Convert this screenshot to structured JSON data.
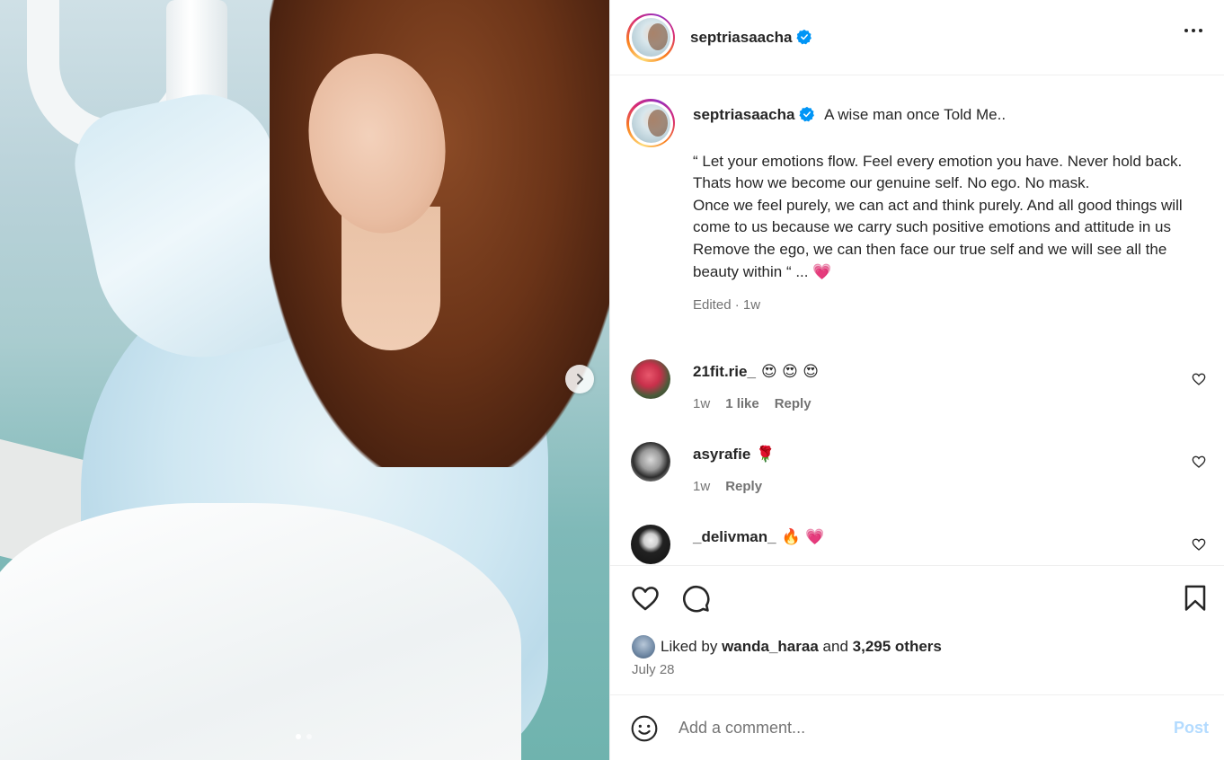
{
  "post": {
    "author": "septriasaacha",
    "verified_icon": "verified-badge-icon",
    "more_icon": "more-options-icon",
    "carousel": {
      "current_index": 1,
      "total": 2,
      "next_icon": "chevron-right-icon"
    }
  },
  "caption": {
    "username": "septriasaacha",
    "first_line": "A wise man once Told Me..",
    "body": "“ Let your emotions flow. Feel every emotion you have. Never hold back. Thats how we become our genuine self. No ego. No mask.\nOnce we feel purely, we can act and think purely. And all good things will come to us because we carry such positive emotions and attitude in us\nRemove the ego, we can then face our true self and we will see all the beauty within “ ... 💗",
    "meta": "Edited · 1w"
  },
  "comments": [
    {
      "username": "21fit.rie_",
      "text": "😍 😍 😍",
      "time": "1w",
      "likes": "1 like",
      "reply": "Reply"
    },
    {
      "username": "asyrafie",
      "text": "🌹",
      "time": "1w",
      "likes": "",
      "reply": "Reply"
    },
    {
      "username": "_delivman_",
      "text": "🔥 💗",
      "time": "",
      "likes": "",
      "reply": ""
    }
  ],
  "actions": {
    "like_icon": "heart-icon",
    "comment_icon": "comment-icon",
    "save_icon": "bookmark-icon"
  },
  "likes": {
    "prefix": "Liked by",
    "user": "wanda_haraa",
    "and": "and",
    "others": "3,295 others"
  },
  "date": "July 28",
  "add_comment": {
    "emoji_icon": "emoji-smile-icon",
    "placeholder": "Add a comment...",
    "post_label": "Post"
  },
  "colors": {
    "verified": "#0095f6",
    "post_disabled": "#b3dbff",
    "secondary_text": "#737373"
  }
}
